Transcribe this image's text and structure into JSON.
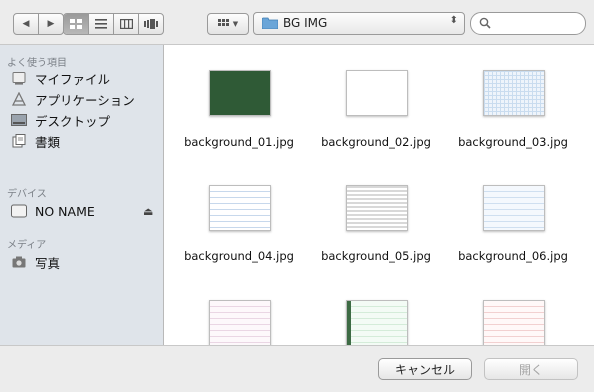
{
  "toolbar": {
    "path_label": "BG IMG"
  },
  "sidebar": {
    "favorites_heading": "よく使う項目",
    "favorites": [
      {
        "label": "マイファイル"
      },
      {
        "label": "アプリケーション"
      },
      {
        "label": "デスクトップ"
      },
      {
        "label": "書類"
      }
    ],
    "devices_heading": "デバイス",
    "devices": [
      {
        "label": "NO NAME"
      }
    ],
    "media_heading": "メディア",
    "media": [
      {
        "label": "写真"
      }
    ]
  },
  "files": [
    {
      "name": "background_01.jpg",
      "style": "dark-green"
    },
    {
      "name": "background_02.jpg",
      "style": "white"
    },
    {
      "name": "background_03.jpg",
      "style": "blue-grid"
    },
    {
      "name": "background_04.jpg",
      "style": "blue-lines"
    },
    {
      "name": "background_05.jpg",
      "style": "gray-stripes"
    },
    {
      "name": "background_06.jpg",
      "style": "light-blue-lines"
    },
    {
      "name": "",
      "style": "pink-lines"
    },
    {
      "name": "",
      "style": "green-lines"
    },
    {
      "name": "",
      "style": "red-lines"
    }
  ],
  "footer": {
    "cancel_label": "キャンセル",
    "open_label": "開く"
  },
  "colors": {
    "sidebar_bg": "#dfe4ea",
    "folder_blue": "#6aa5d8"
  }
}
